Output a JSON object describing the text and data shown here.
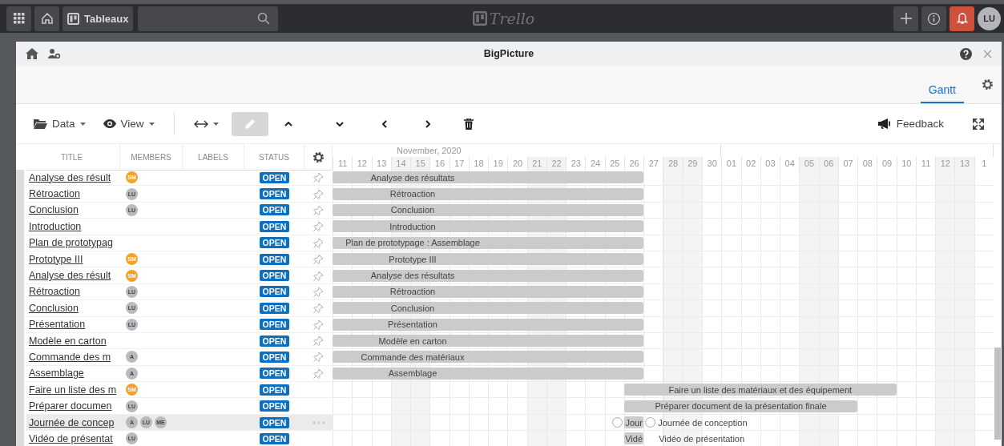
{
  "topbar": {
    "boards_button": {
      "label": "Tableaux"
    },
    "logo_text": "Trello",
    "notifications": {
      "alert": true
    },
    "avatar": {
      "initials": "LU"
    }
  },
  "window": {
    "title": "BigPicture"
  },
  "tabs": [
    {
      "label": "Gantt",
      "selected": true
    }
  ],
  "toolbar": {
    "data_menu": {
      "label": "Data"
    },
    "view_menu": {
      "label": "View"
    },
    "pencil_button": {
      "selected": true
    },
    "feedback_button": {
      "label": "Feedback"
    }
  },
  "table": {
    "columns": [
      "TITLE",
      "MEMBERS",
      "LABELS",
      "STATUS"
    ],
    "rows": [
      {
        "title": "Analyse des résult",
        "members": [
          {
            "initials": "SM",
            "color": "#f2a12e"
          }
        ],
        "status": "OPEN",
        "pin": true,
        "more_menu": false,
        "highlighted": false,
        "bar": {
          "label": "Analyse des résultats"
        }
      },
      {
        "title": "Rétroaction",
        "members": [
          {
            "initials": "LU",
            "color": "#b8babd"
          }
        ],
        "status": "OPEN",
        "pin": true,
        "more_menu": false,
        "highlighted": false,
        "bar": {
          "label": "Rétroaction"
        }
      },
      {
        "title": "Conclusion",
        "members": [
          {
            "initials": "LU",
            "color": "#b8babd"
          }
        ],
        "status": "OPEN",
        "pin": true,
        "more_menu": false,
        "highlighted": false,
        "bar": {
          "label": "Conclusion"
        }
      },
      {
        "title": "Introduction",
        "members": [],
        "status": "OPEN",
        "pin": true,
        "more_menu": false,
        "highlighted": false,
        "bar": {
          "label": "Introduction"
        }
      },
      {
        "title": "Plan de prototypag",
        "members": [],
        "status": "OPEN",
        "pin": true,
        "more_menu": false,
        "highlighted": false,
        "bar": {
          "label": "Plan de prototypage : Assemblage"
        }
      },
      {
        "title": "Prototype III",
        "members": [
          {
            "initials": "SM",
            "color": "#f2a12e"
          }
        ],
        "status": "OPEN",
        "pin": true,
        "more_menu": false,
        "highlighted": false,
        "bar": {
          "label": "Prototype III"
        }
      },
      {
        "title": "Analyse des résult",
        "members": [
          {
            "initials": "SM",
            "color": "#f2a12e"
          }
        ],
        "status": "OPEN",
        "pin": true,
        "more_menu": false,
        "highlighted": false,
        "bar": {
          "label": "Analyse des résultats"
        }
      },
      {
        "title": "Rétroaction",
        "members": [
          {
            "initials": "LU",
            "color": "#b8babd"
          }
        ],
        "status": "OPEN",
        "pin": true,
        "more_menu": false,
        "highlighted": false,
        "bar": {
          "label": "Rétroaction"
        }
      },
      {
        "title": "Conclusion",
        "members": [
          {
            "initials": "LU",
            "color": "#b8babd"
          }
        ],
        "status": "OPEN",
        "pin": true,
        "more_menu": false,
        "highlighted": false,
        "bar": {
          "label": "Conclusion"
        }
      },
      {
        "title": "Présentation",
        "members": [
          {
            "initials": "LU",
            "color": "#b8babd"
          }
        ],
        "status": "OPEN",
        "pin": true,
        "more_menu": false,
        "highlighted": false,
        "bar": {
          "label": "Présentation"
        }
      },
      {
        "title": "Modèle en carton",
        "members": [],
        "status": "OPEN",
        "pin": true,
        "more_menu": false,
        "highlighted": false,
        "bar": {
          "label": "Modèle en carton"
        }
      },
      {
        "title": "Commande des m",
        "members": [
          {
            "initials": "A",
            "color": "#b8babd"
          }
        ],
        "status": "OPEN",
        "pin": true,
        "more_menu": false,
        "highlighted": false,
        "bar": {
          "label": "Commande des matériaux"
        }
      },
      {
        "title": "Assemblage",
        "members": [
          {
            "initials": "A",
            "color": "#b8babd"
          }
        ],
        "status": "OPEN",
        "pin": true,
        "more_menu": false,
        "highlighted": false,
        "bar": {
          "label": "Assemblage"
        }
      },
      {
        "title": "Faire un liste des m",
        "members": [
          {
            "initials": "SM",
            "color": "#f2a12e"
          }
        ],
        "status": "OPEN",
        "pin": false,
        "more_menu": false,
        "highlighted": false,
        "bar": {
          "label": "Faire un liste des matériaux et des équipement"
        }
      },
      {
        "title": "Préparer documen",
        "members": [
          {
            "initials": "LU",
            "color": "#b8babd"
          }
        ],
        "status": "OPEN",
        "pin": false,
        "more_menu": false,
        "highlighted": false,
        "bar": {
          "label": "Préparer document de la présentation finale"
        }
      },
      {
        "title": "Journée de concep",
        "members": [
          {
            "initials": "A",
            "color": "#b8babd"
          },
          {
            "initials": "LU",
            "color": "#b8babd"
          },
          {
            "initials": "ME",
            "color": "#b8babd"
          }
        ],
        "status": "OPEN",
        "pin": false,
        "more_menu": true,
        "highlighted": true,
        "bar": {
          "label": "Jour",
          "milestones": true,
          "outside_label": "Journée de conception"
        }
      },
      {
        "title": "Vidéo de présentat",
        "members": [
          {
            "initials": "LU",
            "color": "#b8babd"
          }
        ],
        "status": "OPEN",
        "pin": false,
        "more_menu": false,
        "highlighted": false,
        "bar": {
          "label": "Vidé",
          "milestones": false,
          "outside_label": "Vidéo de présentation"
        }
      }
    ]
  },
  "gantt": {
    "months": [
      {
        "label": "November, 2020",
        "days": [
          {
            "label": "11",
            "weekend": false
          },
          {
            "label": "12",
            "weekend": false
          },
          {
            "label": "13",
            "weekend": false
          },
          {
            "label": "14",
            "weekend": true
          },
          {
            "label": "15",
            "weekend": true
          },
          {
            "label": "16",
            "weekend": false
          },
          {
            "label": "17",
            "weekend": false
          },
          {
            "label": "18",
            "weekend": false
          },
          {
            "label": "19",
            "weekend": false
          },
          {
            "label": "20",
            "weekend": false
          },
          {
            "label": "21",
            "weekend": true
          },
          {
            "label": "22",
            "weekend": true
          },
          {
            "label": "23",
            "weekend": false
          },
          {
            "label": "24",
            "weekend": false
          },
          {
            "label": "25",
            "weekend": false
          },
          {
            "label": "26",
            "weekend": false
          },
          {
            "label": "27",
            "weekend": false
          },
          {
            "label": "28",
            "weekend": true
          },
          {
            "label": "29",
            "weekend": true
          },
          {
            "label": "30",
            "weekend": false
          }
        ]
      },
      {
        "days": [
          {
            "label": "01",
            "weekend": false
          },
          {
            "label": "02",
            "weekend": false
          },
          {
            "label": "03",
            "weekend": false
          },
          {
            "label": "04",
            "weekend": false
          },
          {
            "label": "05",
            "weekend": true
          },
          {
            "label": "06",
            "weekend": true
          },
          {
            "label": "07",
            "weekend": false
          },
          {
            "label": "08",
            "weekend": false
          },
          {
            "label": "09",
            "weekend": false
          },
          {
            "label": "10",
            "weekend": false
          },
          {
            "label": "11",
            "weekend": false
          },
          {
            "label": "12",
            "weekend": true
          },
          {
            "label": "13",
            "weekend": true
          },
          {
            "label": "1",
            "weekend": false
          }
        ]
      }
    ]
  }
}
